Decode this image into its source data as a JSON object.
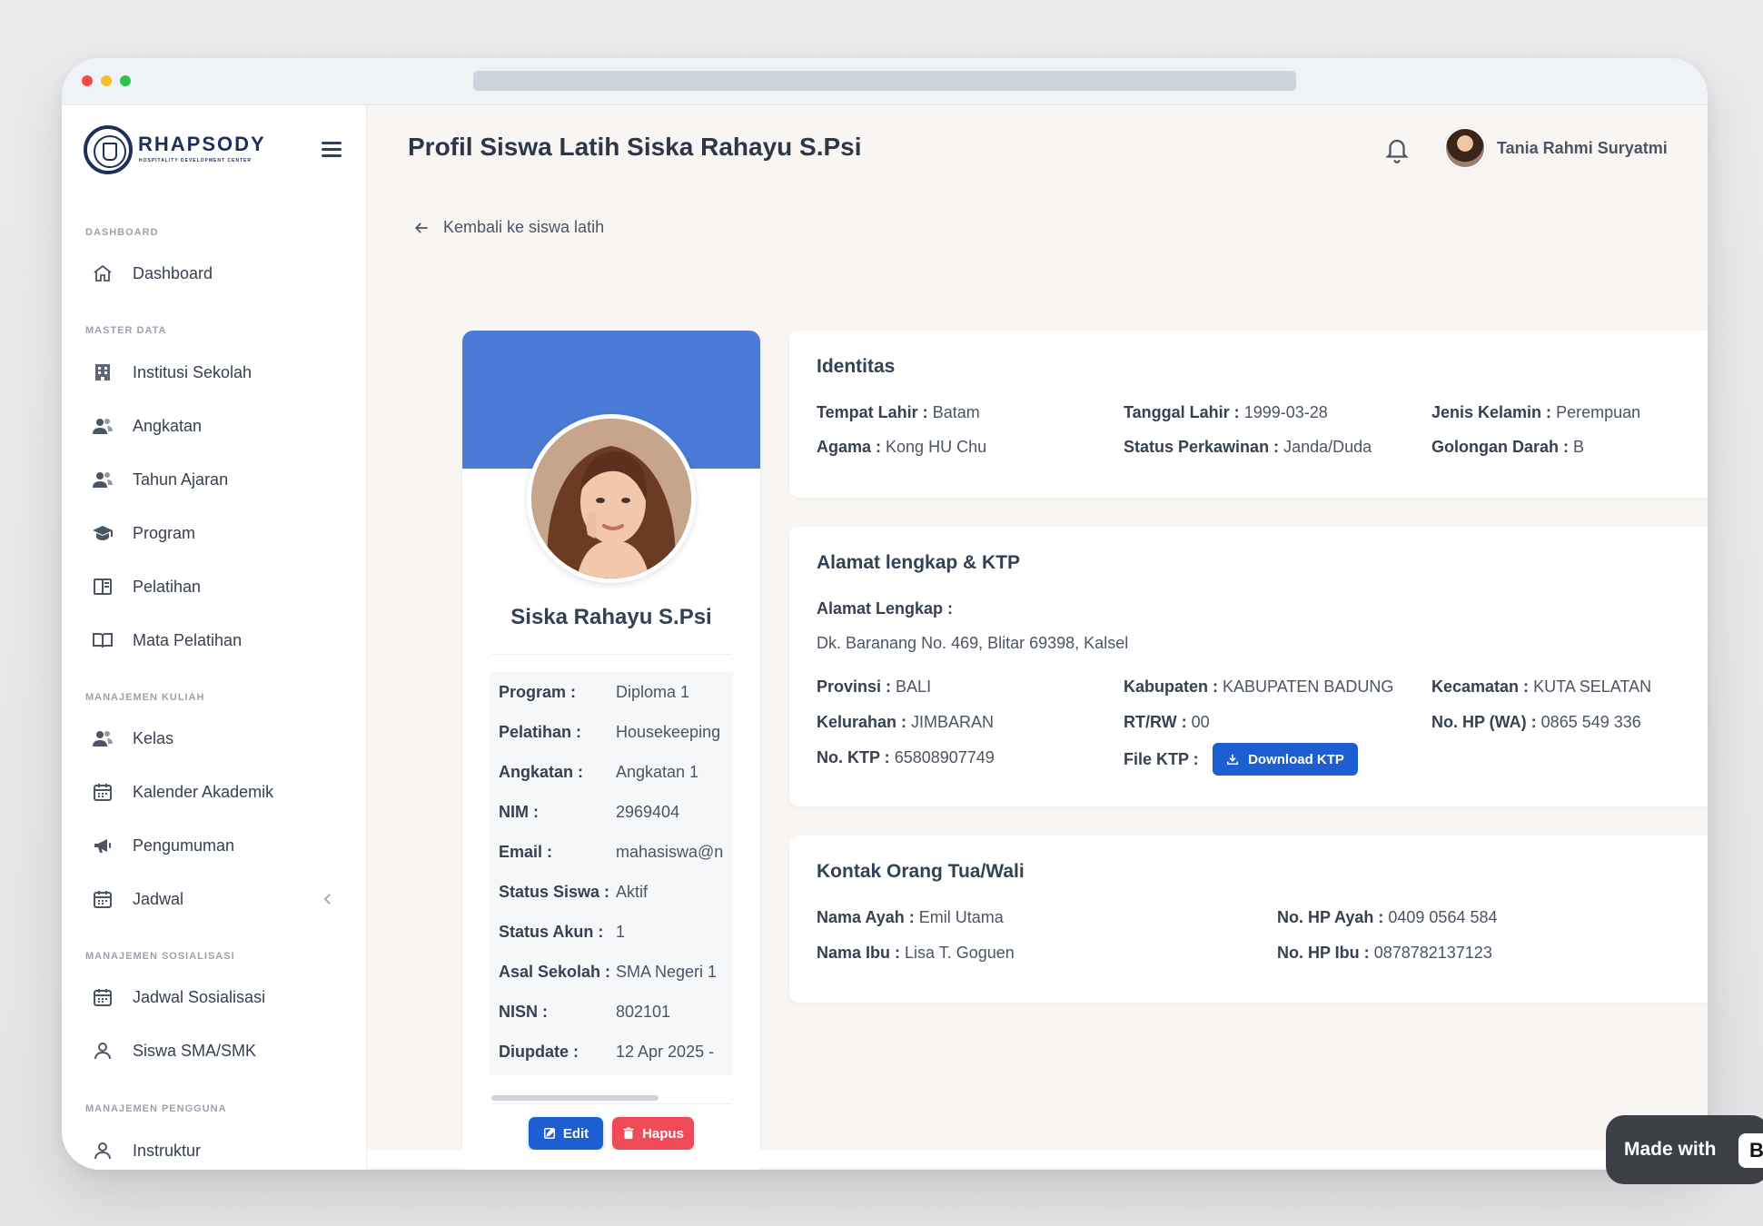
{
  "brand": {
    "name": "RHAPSODY",
    "tagline": "HOSPITALITY DEVELOPMENT CENTER"
  },
  "sidebar": {
    "sections": [
      {
        "label": "DASHBOARD"
      },
      {
        "label": "MASTER DATA"
      },
      {
        "label": "MANAJEMEN KULIAH"
      },
      {
        "label": "MANAJEMEN SOSIALISASI"
      },
      {
        "label": "MANAJEMEN PENGGUNA"
      }
    ],
    "items": [
      {
        "label": "Dashboard",
        "icon": "home-icon"
      },
      {
        "label": "Institusi Sekolah",
        "icon": "building-icon"
      },
      {
        "label": "Angkatan",
        "icon": "users-icon"
      },
      {
        "label": "Tahun Ajaran",
        "icon": "users-icon"
      },
      {
        "label": "Program",
        "icon": "graduation-cap-icon"
      },
      {
        "label": "Pelatihan",
        "icon": "book-icon"
      },
      {
        "label": "Mata Pelatihan",
        "icon": "open-book-icon"
      },
      {
        "label": "Kelas",
        "icon": "users-icon"
      },
      {
        "label": "Kalender Akademik",
        "icon": "calendar-icon"
      },
      {
        "label": "Pengumuman",
        "icon": "megaphone-icon"
      },
      {
        "label": "Jadwal",
        "icon": "calendar-icon"
      },
      {
        "label": "Jadwal Sosialisasi",
        "icon": "calendar-icon"
      },
      {
        "label": "Siswa SMA/SMK",
        "icon": "user-icon"
      },
      {
        "label": "Instruktur",
        "icon": "user-icon"
      }
    ]
  },
  "header": {
    "title": "Profil Siswa Latih Siska Rahayu S.Psi",
    "user_name": "Tania Rahmi Suryatmi"
  },
  "back_link": "Kembali ke siswa latih",
  "profile": {
    "name": "Siska Rahayu S.Psi",
    "rows": [
      {
        "key": "Program :",
        "value": "Diploma 1"
      },
      {
        "key": "Pelatihan :",
        "value": "Housekeeping"
      },
      {
        "key": "Angkatan :",
        "value": "Angkatan 1"
      },
      {
        "key": "NIM :",
        "value": "2969404"
      },
      {
        "key": "Email :",
        "value": "mahasiswa@n"
      },
      {
        "key": "Status Siswa :",
        "value": "Aktif"
      },
      {
        "key": "Status Akun :",
        "value": "1"
      },
      {
        "key": "Asal Sekolah :",
        "value": "SMA Negeri 1"
      },
      {
        "key": "NISN :",
        "value": "802101"
      },
      {
        "key": "Diupdate :",
        "value": "12 Apr 2025 -"
      }
    ],
    "edit_label": "Edit",
    "delete_label": "Hapus"
  },
  "identitas": {
    "title": "Identitas",
    "tempat_lahir": {
      "label": "Tempat Lahir :",
      "value": "Batam"
    },
    "tanggal_lahir": {
      "label": "Tanggal Lahir :",
      "value": "1999-03-28"
    },
    "jenis_kelamin": {
      "label": "Jenis Kelamin :",
      "value": "Perempuan"
    },
    "agama": {
      "label": "Agama :",
      "value": "Kong HU Chu"
    },
    "status_perkawinan": {
      "label": "Status Perkawinan :",
      "value": "Janda/Duda"
    },
    "golongan_darah": {
      "label": "Golongan Darah :",
      "value": "B"
    }
  },
  "alamat": {
    "title": "Alamat lengkap & KTP",
    "alamat_label": "Alamat Lengkap :",
    "alamat_value": "Dk. Baranang No. 469, Blitar 69398, Kalsel",
    "provinsi": {
      "label": "Provinsi :",
      "value": "BALI"
    },
    "kabupaten": {
      "label": "Kabupaten :",
      "value": "KABUPATEN BADUNG"
    },
    "kecamatan": {
      "label": "Kecamatan :",
      "value": "KUTA SELATAN"
    },
    "kelurahan": {
      "label": "Kelurahan :",
      "value": "JIMBARAN"
    },
    "rtrw": {
      "label": "RT/RW :",
      "value": "00"
    },
    "hp_wa": {
      "label": "No. HP (WA) :",
      "value": "0865 549 336"
    },
    "ktp": {
      "label": "No. KTP :",
      "value": "65808907749"
    },
    "file_ktp_label": "File KTP :",
    "download_label": "Download KTP"
  },
  "kontak": {
    "title": "Kontak Orang Tua/Wali",
    "ayah": {
      "label": "Nama Ayah :",
      "value": "Emil Utama"
    },
    "hp_ayah": {
      "label": "No. HP Ayah :",
      "value": "0409 0564 584"
    },
    "ibu": {
      "label": "Nama Ibu :",
      "value": "Lisa T. Goguen"
    },
    "hp_ibu": {
      "label": "No. HP Ibu :",
      "value": "0878782137123"
    }
  },
  "badge": {
    "text": "Made with",
    "logo_glyph": "B"
  },
  "colors": {
    "primary": "#1d5fd1",
    "banner": "#4a7bd6",
    "danger": "#ef4b57",
    "brand": "#1e2f5a"
  }
}
